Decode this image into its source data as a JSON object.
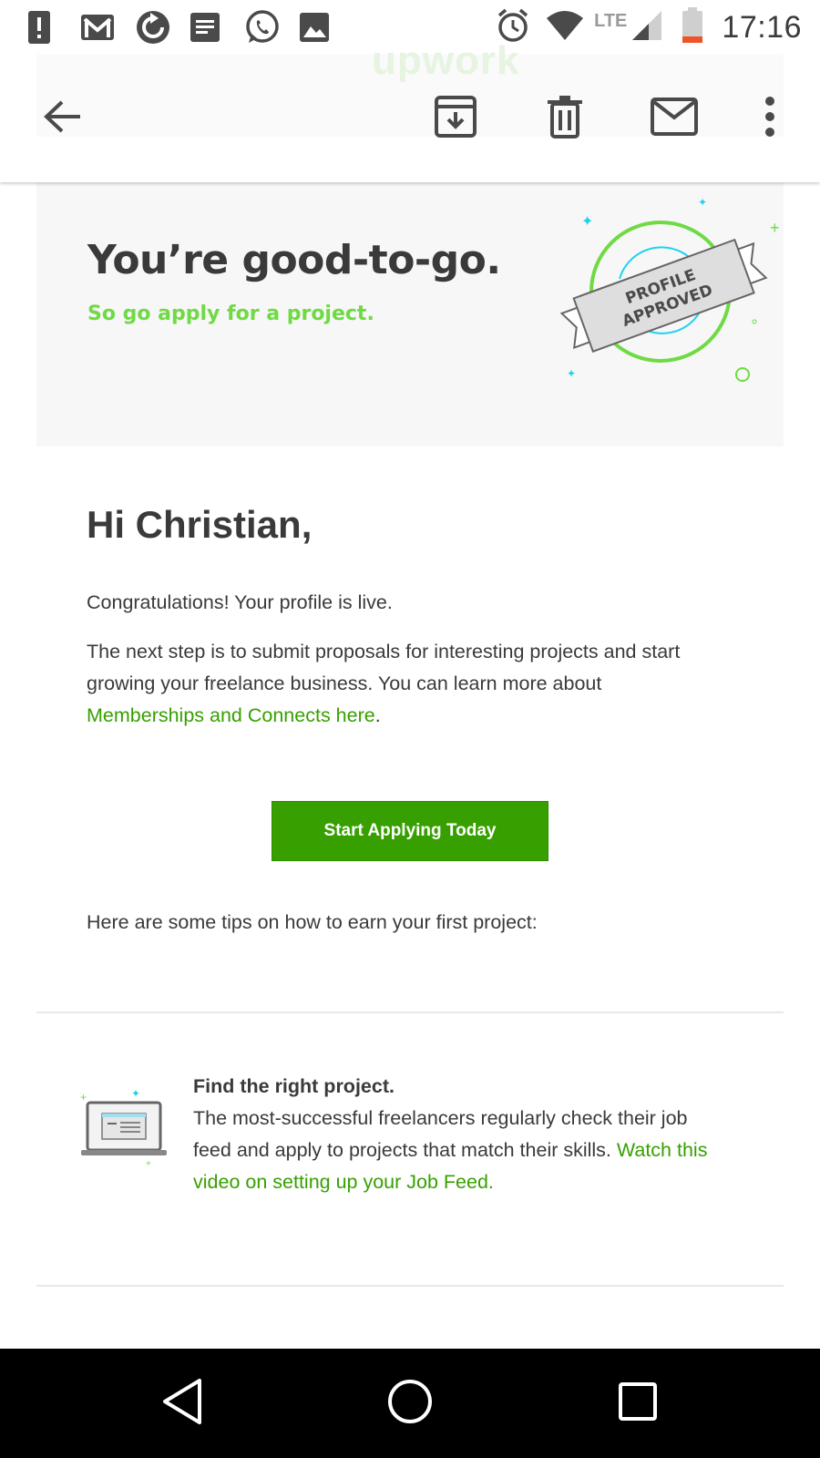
{
  "status_bar": {
    "time": "17:16",
    "network_label": "LTE",
    "left_icons": [
      "alert-icon",
      "gmail-icon",
      "sync-icon",
      "notes-icon",
      "whatsapp-icon",
      "image-icon"
    ],
    "right_icons": [
      "alarm-icon",
      "wifi-icon",
      "cell-signal-icon",
      "battery-low-icon"
    ]
  },
  "toolbar": {
    "header_logo": "upwork",
    "actions": [
      "back-arrow-icon",
      "archive-icon",
      "delete-icon",
      "mark-unread-icon",
      "more-vert-icon"
    ]
  },
  "email": {
    "hero": {
      "title": "You’re good-to-go.",
      "subtitle": "So go apply for a project.",
      "badge_text_line1": "PROFILE",
      "badge_text_line2": "APPROVED"
    },
    "greeting": "Hi Christian,",
    "congrats": "Congratulations! Your profile is live.",
    "next_step_text": "The next step is to submit proposals for interesting projects and start growing your freelance business. You can learn more about ",
    "memberships_link": "Memberships and Connects here",
    "period": ".",
    "cta_label": "Start Applying Today",
    "tips_intro": "Here are some tips on how to earn your first project:",
    "tip": {
      "title": "Find the right project.",
      "body": "The most-successful freelancers regularly check their job feed and apply to projects that match their skills. ",
      "link": "Watch this video on setting up your Job Feed."
    }
  },
  "colors": {
    "brand_green": "#37a000",
    "accent_green": "#6fda44",
    "accent_cyan": "#1ed2f0",
    "text": "#3a3a3a"
  },
  "nav_bar": [
    "back-triangle-icon",
    "home-circle-icon",
    "recents-square-icon"
  ]
}
